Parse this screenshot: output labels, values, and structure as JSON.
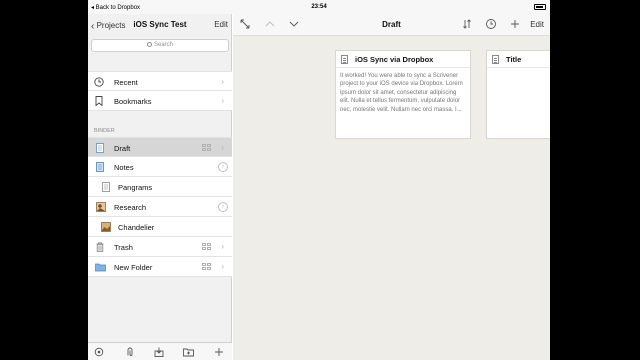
{
  "status_bar": {
    "back_label": "◂ Back to Dropbox",
    "time": "23:54"
  },
  "sidebar": {
    "nav": {
      "back_label": "Projects",
      "title": "iOS Sync Test",
      "edit_label": "Edit"
    },
    "search_placeholder": "Search",
    "items": [
      {
        "label": "Recent"
      },
      {
        "label": "Bookmarks"
      }
    ],
    "binder_header": "BINDER",
    "binder": [
      {
        "label": "Draft"
      },
      {
        "label": "Notes"
      },
      {
        "label": "Pangrams"
      },
      {
        "label": "Research"
      },
      {
        "label": "Chandelier"
      },
      {
        "label": "Trash"
      },
      {
        "label": "New Folder"
      }
    ]
  },
  "main": {
    "nav": {
      "title": "Draft",
      "edit_label": "Edit"
    },
    "cards": [
      {
        "title": "iOS Sync via Dropbox",
        "body": "It worked! You were able to sync a Scrivener project to your iOS device via Dropbox. Lorem ipsum dolor sit amet, consectetur adipiscing elit. Nulla et tellus fermentum, vulputate dolor nec, molestie velit. Nullam nec orci massa. I..."
      },
      {
        "title": "Title",
        "body": ""
      }
    ]
  },
  "colors": {
    "accent": "#333333",
    "sidebar_bg": "#f1f1f2",
    "corkboard_bg": "#efede8",
    "selected_row": "#d6d6d6"
  },
  "icons": [
    "clock-icon",
    "bookmark-icon",
    "document-icon",
    "notes-icon",
    "image-icon",
    "trash-icon",
    "folder-icon",
    "grid-icon",
    "chevron-right-icon",
    "info-circle-icon",
    "settings-icon",
    "clip-icon",
    "import-icon",
    "new-folder-icon",
    "add-icon",
    "expand-icon",
    "arrow-up-icon",
    "arrow-down-icon",
    "sort-icon",
    "history-icon"
  ]
}
